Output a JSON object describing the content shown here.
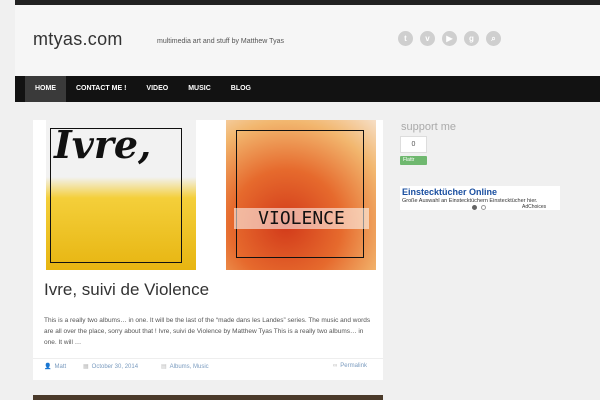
{
  "header": {
    "site_title": "mtyas.com",
    "tagline": "multimedia art and stuff by Matthew Tyas",
    "social_icons": [
      "twitter-icon",
      "vimeo-icon",
      "youtube-icon",
      "googleplus-icon",
      "search-icon"
    ]
  },
  "nav": {
    "items": [
      {
        "label": "HOME",
        "active": true
      },
      {
        "label": "CONTACT ME !"
      },
      {
        "label": "VIDEO"
      },
      {
        "label": "MUSIC"
      },
      {
        "label": "BLOG"
      }
    ]
  },
  "post": {
    "image1_text": "Ivre,",
    "image2_text": "VIOLENCE",
    "title": "Ivre, suivi de Violence",
    "excerpt": "This is a really two albums… in one. It will be the last of the “made dans les Landes” series. The music and words are all over the place, sorry about that ! Ivre, suivi de Violence by Matthew Tyas This is a really two albums… in one. It will …",
    "author": "Matt",
    "date": "October 30, 2014",
    "categories": "Albums, Music",
    "permalink": "Permalink"
  },
  "sidebar": {
    "support_title": "support me",
    "flattr_count": "0",
    "flattr_label": "Flattr",
    "ad_title": "Einstecktücher Online",
    "ad_text": "Große Auswahl an Einstecktüchern Einstecktücher hier.",
    "ad_choices": "AdChoices"
  }
}
